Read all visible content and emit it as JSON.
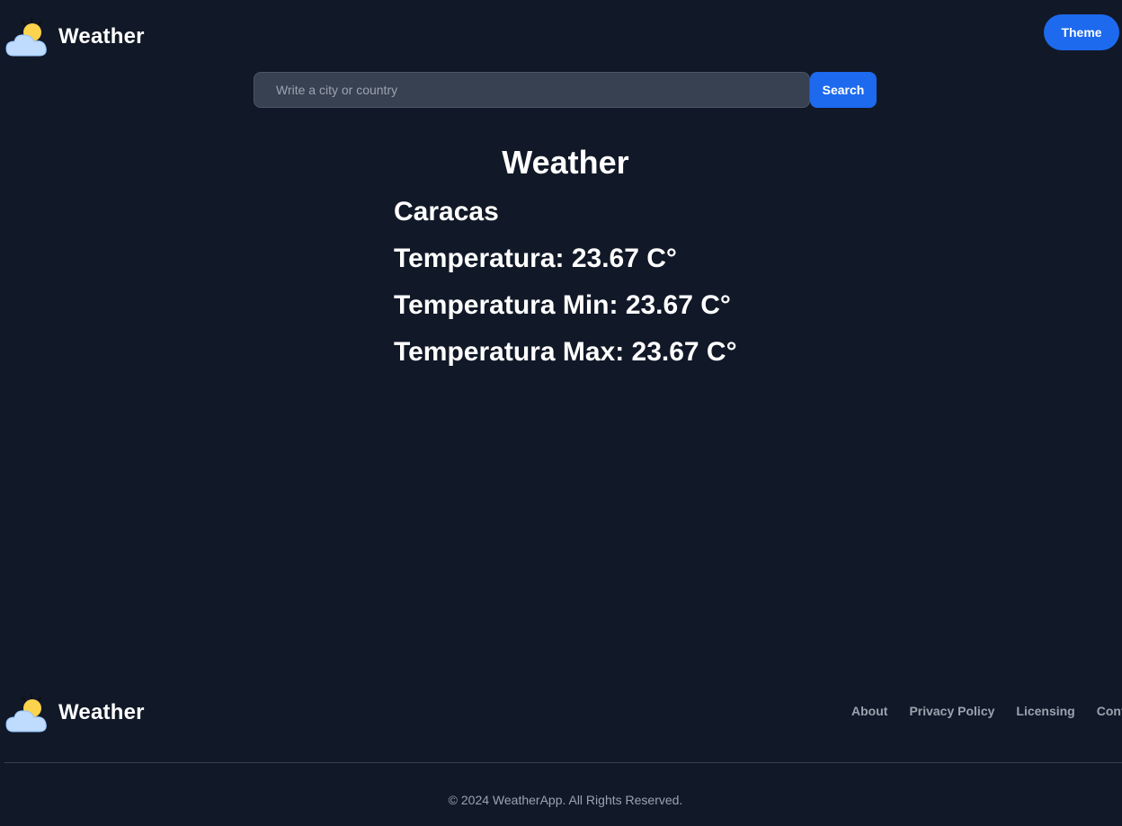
{
  "header": {
    "brand_name": "Weather",
    "logo_icon": "sun-cloud-icon",
    "theme_label": "Theme"
  },
  "search": {
    "placeholder": "Write a city or country",
    "value": "",
    "button_label": "Search"
  },
  "main": {
    "title": "Weather",
    "city": "Caracas",
    "temperature": "Temperatura: 23.67 C°",
    "temp_min": "Temperatura Min: 23.67 C°",
    "temp_max": "Temperatura Max: 23.67 C°"
  },
  "footer": {
    "brand_name": "Weather",
    "links": [
      "About",
      "Privacy Policy",
      "Licensing",
      "Contact"
    ],
    "copyright": "© 2024 WeatherApp. All Rights Reserved."
  },
  "colors": {
    "background": "#111827",
    "accent": "#1d6aef",
    "input_bg": "#374151",
    "muted_text": "#9ca3af"
  }
}
